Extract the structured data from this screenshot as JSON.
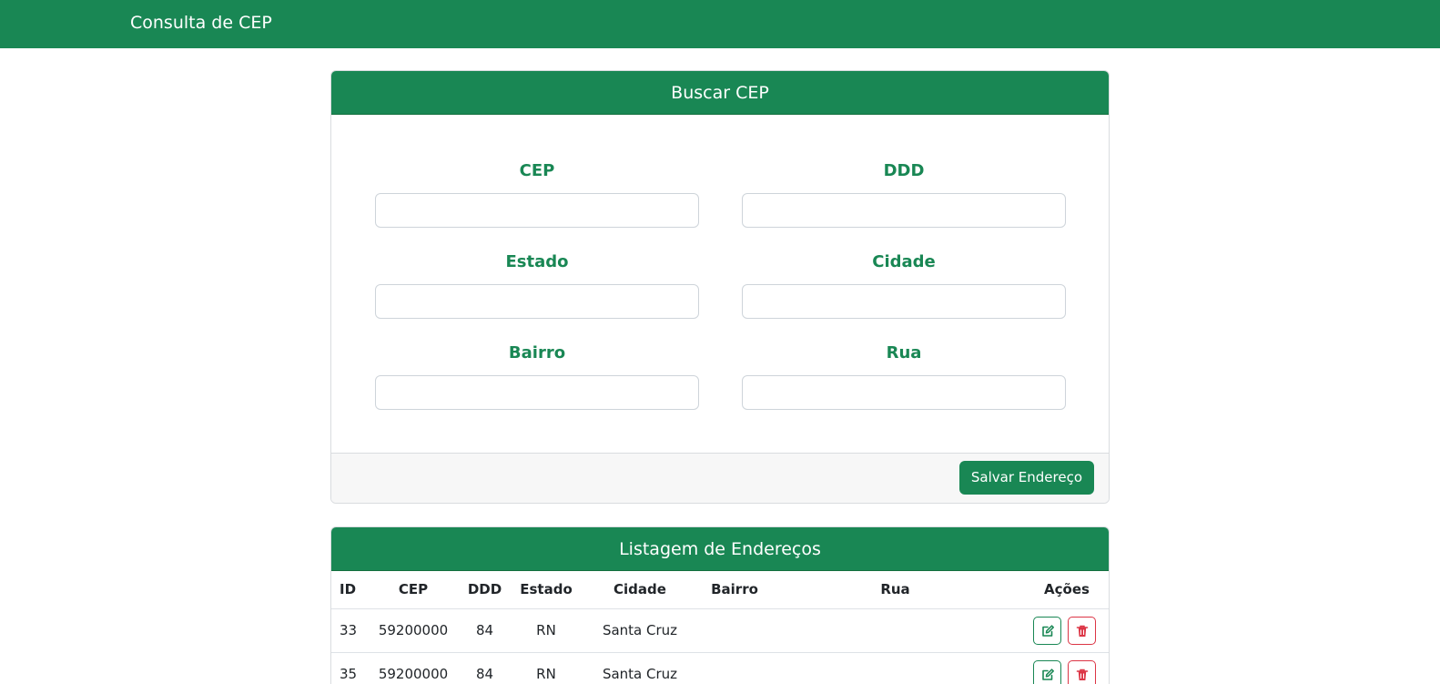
{
  "navbar": {
    "brand": "Consulta de CEP"
  },
  "search_card": {
    "title": "Buscar CEP",
    "fields": {
      "cep": {
        "label": "CEP",
        "value": ""
      },
      "ddd": {
        "label": "DDD",
        "value": ""
      },
      "estado": {
        "label": "Estado",
        "value": ""
      },
      "cidade": {
        "label": "Cidade",
        "value": ""
      },
      "bairro": {
        "label": "Bairro",
        "value": ""
      },
      "rua": {
        "label": "Rua",
        "value": ""
      }
    },
    "save_button": "Salvar Endereço"
  },
  "list_card": {
    "title": "Listagem de Endereços",
    "columns": [
      "ID",
      "CEP",
      "DDD",
      "Estado",
      "Cidade",
      "Bairro",
      "Rua",
      "Ações"
    ],
    "rows": [
      {
        "id": "33",
        "cep": "59200000",
        "ddd": "84",
        "estado": "RN",
        "cidade": "Santa Cruz",
        "bairro": "",
        "rua": ""
      },
      {
        "id": "35",
        "cep": "59200000",
        "ddd": "84",
        "estado": "RN",
        "cidade": "Santa Cruz",
        "bairro": "",
        "rua": ""
      }
    ],
    "actions": {
      "edit_icon": "edit-icon",
      "delete_icon": "trash-icon"
    }
  },
  "colors": {
    "primary": "#198754",
    "danger": "#dc3545"
  }
}
